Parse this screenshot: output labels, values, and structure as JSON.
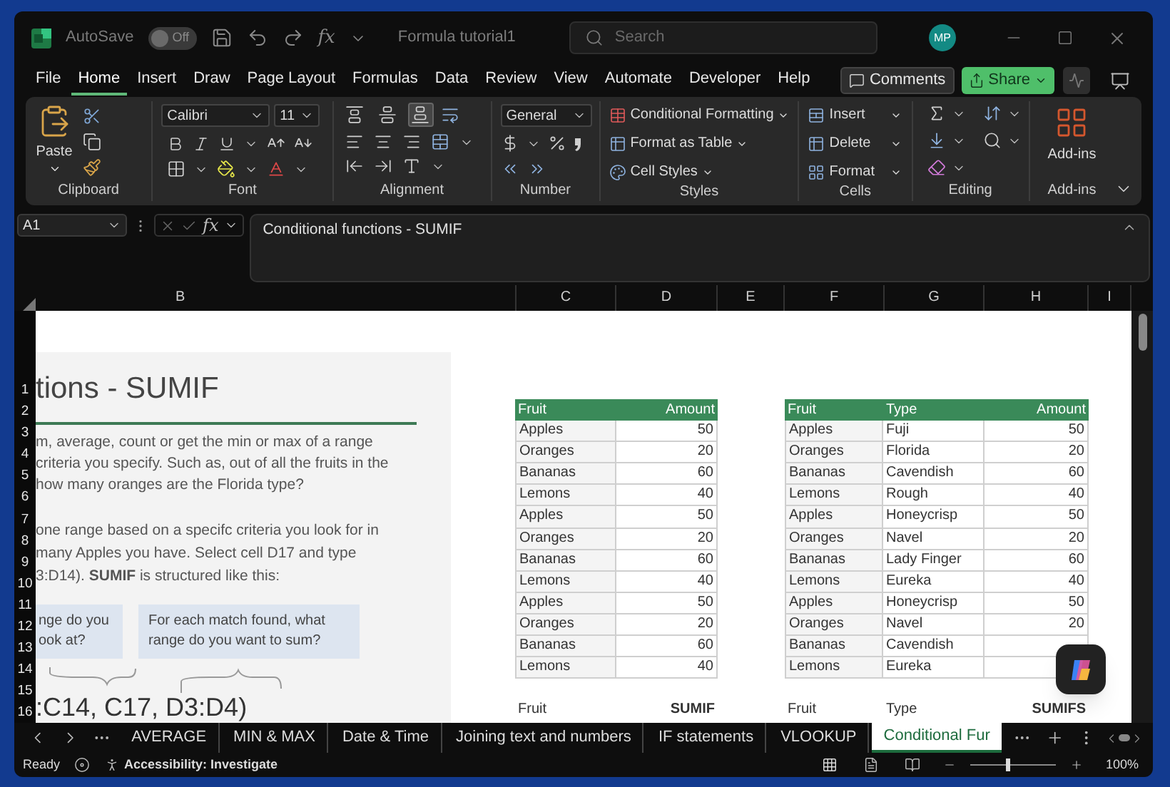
{
  "title_bar": {
    "autosave_label": "AutoSave",
    "autosave_state": "Off",
    "autosave_on": false,
    "fx": "fx",
    "file_name": "Formula tutorial1",
    "search": {
      "placeholder": "Search"
    },
    "avatar": "MP"
  },
  "menu_tabs": [
    {
      "label": "File",
      "selected": false
    },
    {
      "label": "Home",
      "selected": true
    },
    {
      "label": "Insert",
      "selected": false
    },
    {
      "label": "Draw",
      "selected": false
    },
    {
      "label": "Page Layout",
      "selected": false
    },
    {
      "label": "Formulas",
      "selected": false
    },
    {
      "label": "Data",
      "selected": false
    },
    {
      "label": "Review",
      "selected": false
    },
    {
      "label": "View",
      "selected": false
    },
    {
      "label": "Automate",
      "selected": false
    },
    {
      "label": "Developer",
      "selected": false
    },
    {
      "label": "Help",
      "selected": false
    }
  ],
  "menu_buttons": {
    "comments": "Comments",
    "share": "Share"
  },
  "ribbon": {
    "clipboard": {
      "label": "Clipboard",
      "paste": "Paste"
    },
    "font": {
      "label": "Font",
      "family": "Calibri",
      "size": "11"
    },
    "alignment": {
      "label": "Alignment",
      "vertical": [
        {
          "kind": "top",
          "selected": false
        },
        {
          "kind": "middle",
          "selected": false
        },
        {
          "kind": "bottom",
          "selected": true
        }
      ]
    },
    "number": {
      "label": "Number",
      "format": "General"
    },
    "styles": {
      "label": "Styles",
      "items": [
        "Conditional Formatting",
        "Format as Table",
        "Cell Styles"
      ]
    },
    "cells": {
      "label": "Cells",
      "items": [
        "Insert",
        "Delete",
        "Format"
      ]
    },
    "editing": {
      "label": "Editing"
    },
    "addins": {
      "label": "Add-ins",
      "button": "Add-ins"
    }
  },
  "formula_bar": {
    "name_box": "A1",
    "fx": "fx",
    "formula": "Conditional functions - SUMIF"
  },
  "columns": [
    "B",
    "C",
    "D",
    "E",
    "F",
    "G",
    "H",
    "I"
  ],
  "row_numbers": [
    "1",
    "2",
    "3",
    "4",
    "5",
    "6",
    "7",
    "8",
    "9",
    "10",
    "11",
    "12",
    "13",
    "14",
    "15",
    "16"
  ],
  "sheet": {
    "title": "tions - SUMIF",
    "intro_lines": [
      "m, average, count or get the min or max of a range",
      "criteria you specify. Such as, out of all the fruits in the",
      "how many oranges are the Florida type?"
    ],
    "detail_lines": [
      "one range based on a specifc criteria you look for in",
      "many Apples you have. Select cell D17 and type",
      "3:D14). **SUMIF** is structured like this:"
    ],
    "callouts": [
      {
        "lines": [
          "nge do you",
          "ook at?"
        ]
      },
      {
        "lines": [
          "For each match found, what",
          "range do you want to sum?"
        ]
      }
    ],
    "formula_preview": ":C14, C17, D3:D4)"
  },
  "table1": {
    "columns": [
      "Fruit",
      "Amount"
    ],
    "rows": [
      [
        "Apples",
        "50"
      ],
      [
        "Oranges",
        "20"
      ],
      [
        "Bananas",
        "60"
      ],
      [
        "Lemons",
        "40"
      ],
      [
        "Apples",
        "50"
      ],
      [
        "Oranges",
        "20"
      ],
      [
        "Bananas",
        "60"
      ],
      [
        "Lemons",
        "40"
      ],
      [
        "Apples",
        "50"
      ],
      [
        "Oranges",
        "20"
      ],
      [
        "Bananas",
        "60"
      ],
      [
        "Lemons",
        "40"
      ]
    ],
    "summary": [
      "Fruit",
      "SUMIF"
    ]
  },
  "table2": {
    "columns": [
      "Fruit",
      "Type",
      "Amount"
    ],
    "rows": [
      [
        "Apples",
        "Fuji",
        "50"
      ],
      [
        "Oranges",
        "Florida",
        "20"
      ],
      [
        "Bananas",
        "Cavendish",
        "60"
      ],
      [
        "Lemons",
        "Rough",
        "40"
      ],
      [
        "Apples",
        "Honeycrisp",
        "50"
      ],
      [
        "Oranges",
        "Navel",
        "20"
      ],
      [
        "Bananas",
        "Lady Finger",
        "60"
      ],
      [
        "Lemons",
        "Eureka",
        "40"
      ],
      [
        "Apples",
        "Honeycrisp",
        "50"
      ],
      [
        "Oranges",
        "Navel",
        "20"
      ],
      [
        "Bananas",
        "Cavendish"
      ],
      [
        "Lemons",
        "Eureka"
      ]
    ],
    "summary": [
      "Fruit",
      "Type",
      "SUMIFS"
    ]
  },
  "sheet_tabs": [
    {
      "label": "AVERAGE",
      "selected": false
    },
    {
      "label": "MIN & MAX",
      "selected": false
    },
    {
      "label": "Date & Time",
      "selected": false
    },
    {
      "label": "Joining text and numbers",
      "selected": false
    },
    {
      "label": "IF statements",
      "selected": false
    },
    {
      "label": "VLOOKUP",
      "selected": false
    },
    {
      "label": "Conditional Fur",
      "selected": true
    }
  ],
  "status_bar": {
    "ready": "Ready",
    "accessibility": "Accessibility: Investigate",
    "zoom": {
      "level": 0.44,
      "reading": "100%"
    }
  }
}
